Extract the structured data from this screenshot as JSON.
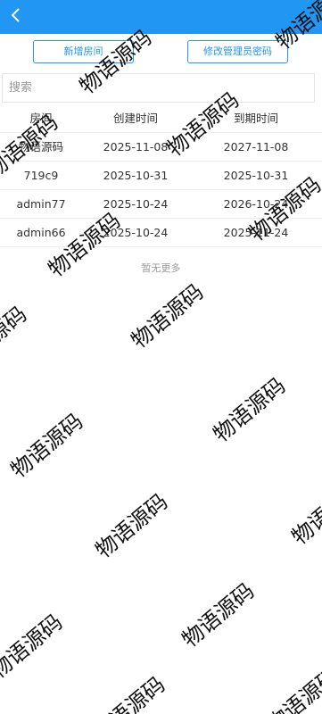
{
  "header": {
    "back_icon": "chevron-left-icon",
    "bg_color": "#2196f3"
  },
  "actions": {
    "add_label": "新增房间",
    "change_password_label": "修改管理员密码"
  },
  "search": {
    "placeholder": "搜索",
    "value": ""
  },
  "table": {
    "columns": [
      "房间",
      "创建时间",
      "到期时间"
    ],
    "rows": [
      [
        "物语源码",
        "2025-11-08",
        "2027-11-08"
      ],
      [
        "719c9",
        "2025-10-31",
        "2025-10-31"
      ],
      [
        "admin77",
        "2025-10-24",
        "2026-10-24"
      ],
      [
        "admin66",
        "2025-10-24",
        "2025-11-24"
      ]
    ]
  },
  "footer": {
    "no_more_text": "暂无更多"
  },
  "watermark": {
    "text": "物语源码"
  }
}
